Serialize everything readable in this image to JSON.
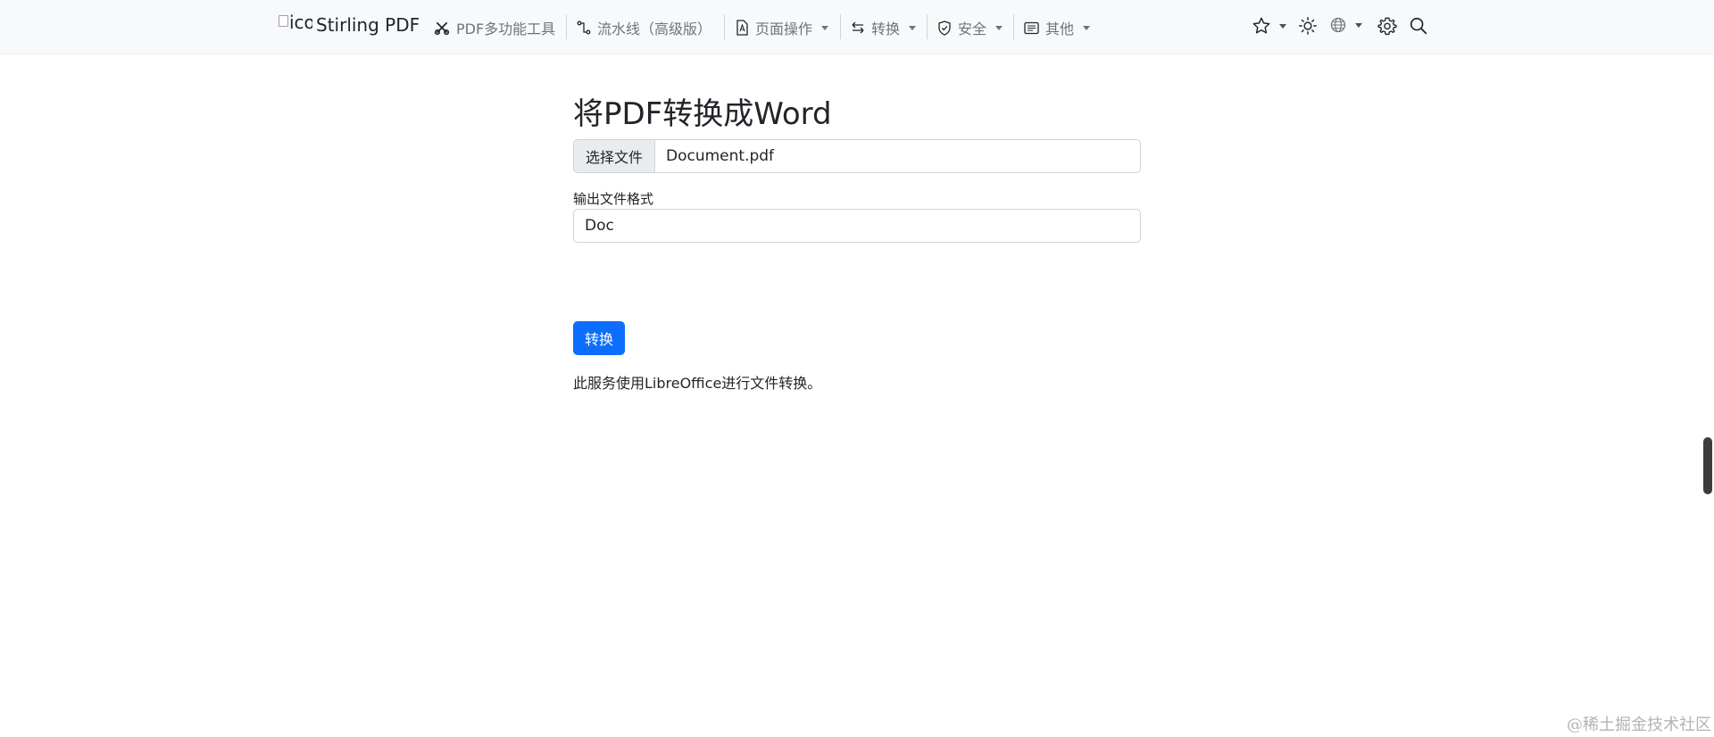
{
  "app": {
    "title": "Stirling PDF",
    "logo_alt": "ico"
  },
  "nav": {
    "items": [
      {
        "label": "PDF多功能工具",
        "icon": "scissors-wrench-icon"
      },
      {
        "label": "流水线（高级版）",
        "icon": "pipeline-icon"
      },
      {
        "label": "页面操作",
        "icon": "pdf-file-icon"
      },
      {
        "label": "转换",
        "icon": "arrows-swap-icon"
      },
      {
        "label": "安全",
        "icon": "shield-icon"
      },
      {
        "label": "其他",
        "icon": "card-list-icon"
      }
    ],
    "right_icons": [
      "star-icon",
      "sun-icon",
      "globe-icon",
      "gear-icon",
      "search-icon"
    ]
  },
  "page": {
    "title": "将PDF转换成Word",
    "file_button_label": "选择文件",
    "file_name": "Document.pdf",
    "format_label": "输出文件格式",
    "format_value": "Doc",
    "submit_label": "转换",
    "note": "此服务使用LibreOffice进行文件转换。"
  },
  "watermark": "@稀土掘金技术社区",
  "colors": {
    "accent": "#0d6efd",
    "navbar_bg": "#f8f9fa",
    "muted_text": "#6c757d"
  }
}
